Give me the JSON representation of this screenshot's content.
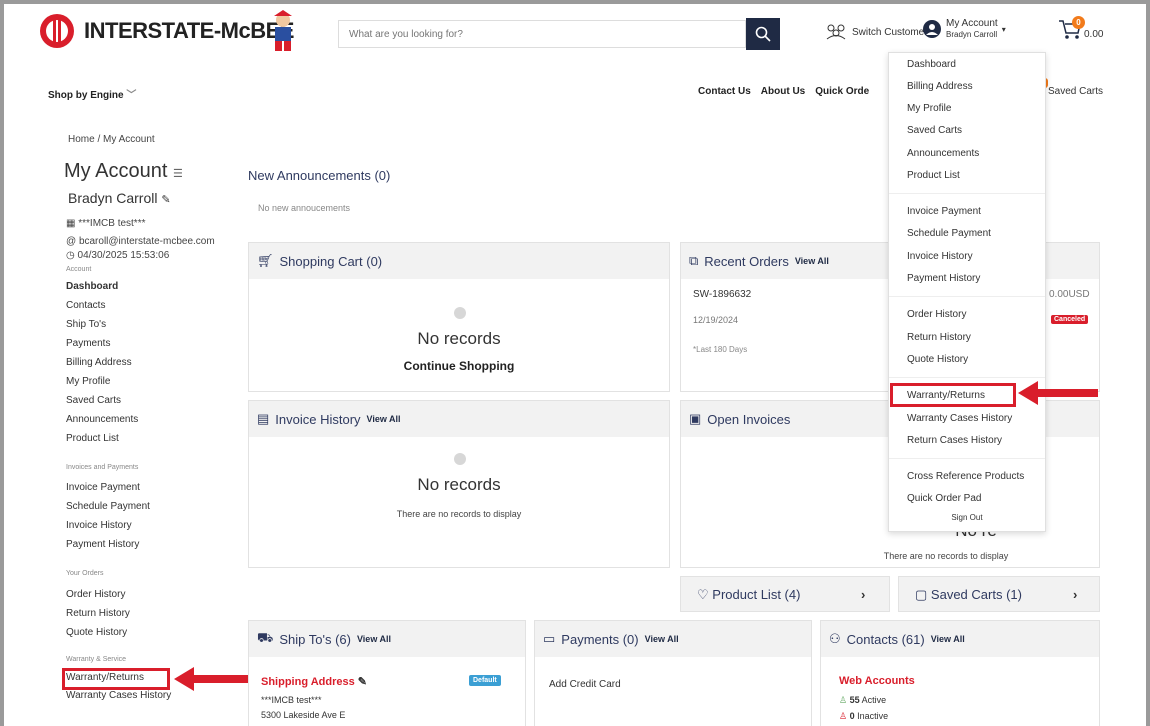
{
  "header": {
    "logo_text": "INTERSTATE-McBEE",
    "search_placeholder": "What are you looking for?",
    "switch_customer": "Switch Customer",
    "account_label": "My Account",
    "account_user": "Bradyn Carroll",
    "cart_total": "0.00",
    "cart_count": "0"
  },
  "nav": {
    "shop_by_engine": "Shop by Engine",
    "links": [
      "Contact Us",
      "About Us",
      "Quick Orde"
    ],
    "saved_carts": "Saved Carts"
  },
  "sidebar": {
    "breadcrumb": "Home / My Account",
    "title": "My Account",
    "user_name": "Bradyn Carroll",
    "company": "***IMCB test***",
    "email": "bcaroll@interstate-mcbee.com",
    "last_login": "04/30/2025 15:53:06",
    "sections": {
      "account": "Account",
      "invoices": "Invoices and Payments",
      "orders": "Your Orders",
      "warranty": "Warranty & Service"
    },
    "account_items": [
      "Dashboard",
      "Contacts",
      "Ship To's",
      "Payments",
      "Billing Address",
      "My Profile",
      "Saved Carts",
      "Announcements",
      "Product List"
    ],
    "invoice_items": [
      "Invoice Payment",
      "Schedule Payment",
      "Invoice History",
      "Payment History"
    ],
    "order_items": [
      "Order History",
      "Return History",
      "Quote History"
    ],
    "warranty_items": [
      "Warranty/Returns",
      "Warranty Cases History"
    ]
  },
  "main": {
    "announcements_title": "New Announcements (0)",
    "announcements_empty": "No new annoucements",
    "shopping_cart": {
      "title": "Shopping Cart (0)",
      "empty": "No records",
      "action": "Continue Shopping"
    },
    "recent_orders": {
      "title": "Recent Orders",
      "view_all": "View All",
      "order_no": "SW-1896632",
      "date": "12/19/2024",
      "amount": "0.00USD",
      "status": "Canceled",
      "note": "*Last 180 Days"
    },
    "invoice_history": {
      "title": "Invoice History",
      "view_all": "View All",
      "empty": "No records",
      "sub": "There are no records to display"
    },
    "open_invoices": {
      "title": "Open Invoices",
      "empty": "No re",
      "sub": "There are no records to display"
    },
    "product_list": "Product List (4)",
    "saved_carts": "Saved Carts (1)",
    "ship_tos": {
      "title": "Ship To's (6)",
      "view_all": "View All",
      "label": "Shipping Address",
      "badge": "Default",
      "line1": "***IMCB test***",
      "line2": "5300 Lakeside Ave E"
    },
    "payments": {
      "title": "Payments (0)",
      "view_all": "View All",
      "add": "Add Credit Card"
    },
    "contacts": {
      "title": "Contacts (61)",
      "view_all": "View All",
      "label": "Web Accounts",
      "active": "55",
      "active_lbl": "Active",
      "inactive": "0",
      "inactive_lbl": "Inactive"
    }
  },
  "dropdown": {
    "group1": [
      "Dashboard",
      "Billing Address",
      "My Profile",
      "Saved Carts",
      "Announcements",
      "Product List"
    ],
    "group2": [
      "Invoice Payment",
      "Schedule Payment",
      "Invoice History",
      "Payment History"
    ],
    "group3": [
      "Order History",
      "Return History",
      "Quote History"
    ],
    "group4": [
      "Warranty/Returns",
      "Warranty Cases History",
      "Return Cases History"
    ],
    "group5": [
      "Cross Reference Products",
      "Quick Order Pad"
    ],
    "sign_out": "Sign Out"
  },
  "colors": {
    "accent": "#d91e2b",
    "navy": "#1f2a44",
    "orange": "#f27b1b"
  }
}
